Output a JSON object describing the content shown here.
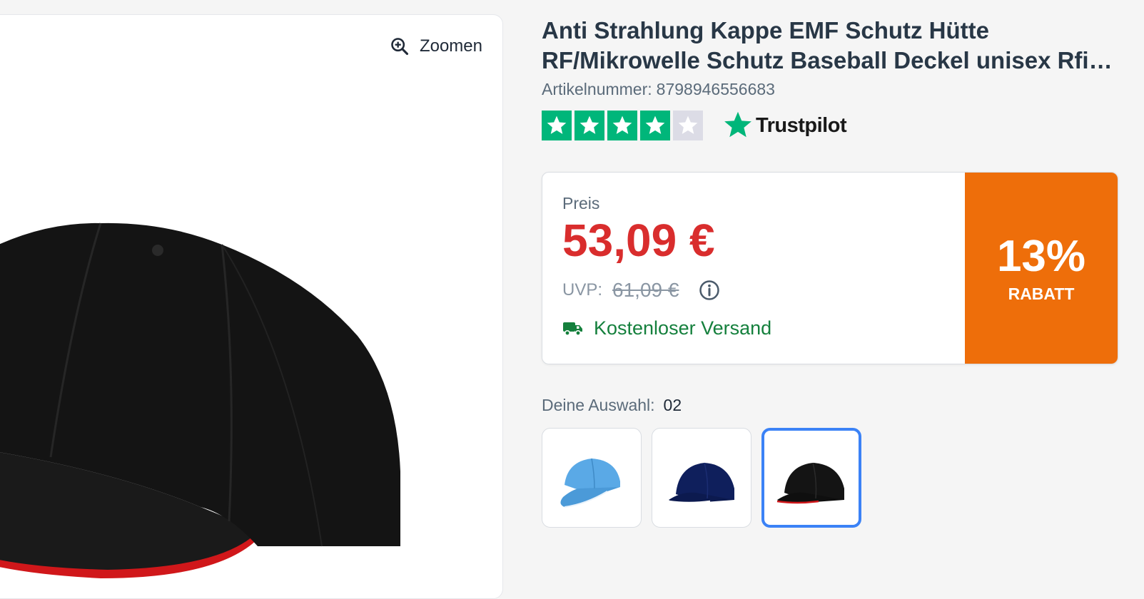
{
  "image_panel": {
    "zoom_label": "Zoomen"
  },
  "product": {
    "title_line1": "Anti Strahlung Kappe EMF Schutz Hütte",
    "title_line2": "RF/Mikrowelle Schutz Baseball Deckel unisex Rfid...",
    "sku_label": "Artikelnummer:",
    "sku_value": "8798946556683"
  },
  "rating": {
    "stars_filled": 4,
    "stars_total": 5,
    "provider": "Trustpilot",
    "filled_color": "#00b67a",
    "empty_color": "#dcdce6"
  },
  "price": {
    "label": "Preis",
    "value": "53,09 €",
    "uvp_label": "UVP:",
    "uvp_value": "61,09 €",
    "shipping": "Kostenloser Versand",
    "price_color": "#d92d2d",
    "shipping_color": "#15803d"
  },
  "discount": {
    "value": "13%",
    "label": "RABATT",
    "color": "#ee6e0a"
  },
  "selection": {
    "label": "Deine Auswahl:",
    "value": "02",
    "variants": [
      {
        "name": "light-blue-cap",
        "color": "#5aa9e6",
        "selected": false
      },
      {
        "name": "navy-cap",
        "color": "#0f1f5c",
        "selected": false
      },
      {
        "name": "black-cap",
        "color": "#141414",
        "selected": true
      }
    ],
    "selected_border_color": "#3b82f6"
  }
}
